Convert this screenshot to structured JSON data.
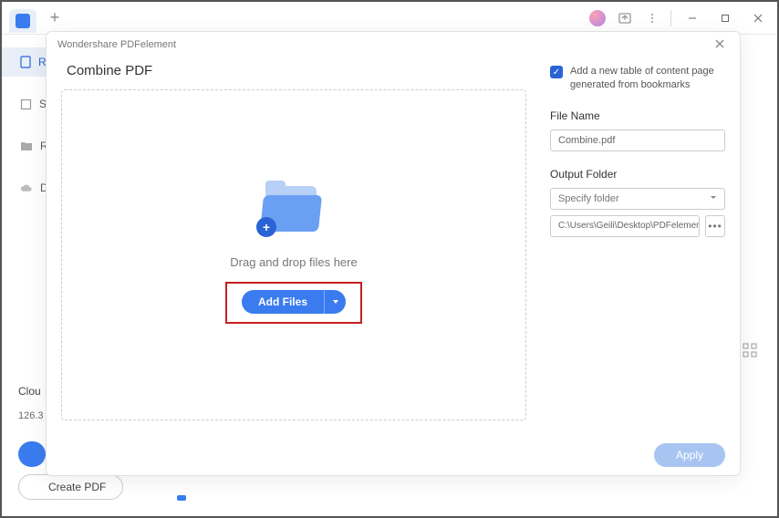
{
  "titlebar": {
    "plus": "+"
  },
  "sidebar": {
    "items": [
      "R",
      "S",
      "R",
      "D"
    ],
    "cloud_label": "Clou",
    "cloud_value": "126.3"
  },
  "create_pdf_label": "Create PDF",
  "modal": {
    "app_title": "Wondershare PDFelement",
    "title": "Combine PDF",
    "drop_text": "Drag and drop files here",
    "add_files_label": "Add Files",
    "checkbox_label": "Add a new table of content page generated from bookmarks",
    "file_name_label": "File Name",
    "file_name_value": "Combine.pdf",
    "output_folder_label": "Output Folder",
    "specify_label": "Specify folder",
    "output_path": "C:\\Users\\Geili\\Desktop\\PDFelement\\Co",
    "apply_label": "Apply"
  }
}
